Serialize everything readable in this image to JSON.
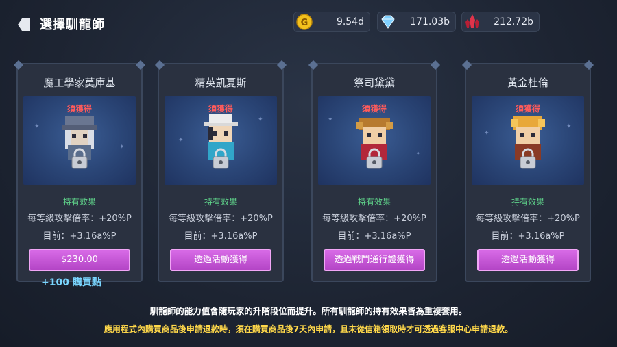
{
  "header": {
    "title": "選擇馴龍師",
    "back_icon": "back-arrow-icon",
    "currencies": [
      {
        "icon": "gold-coin-icon",
        "value": "9.54d",
        "color": "#f3c11d"
      },
      {
        "icon": "diamond-icon",
        "value": "171.03b",
        "color": "#7fd0ff"
      },
      {
        "icon": "red-crystal-icon",
        "value": "212.72b",
        "color": "#e0344b"
      }
    ]
  },
  "cards": [
    {
      "name": "魔工學家莫庫基",
      "tag": "須獲得",
      "effect_title": "持有效果",
      "effect_line1": "每等級攻擊倍率：+20%P",
      "effect_line2": "目前：+3.16a%P",
      "button": "$230.00"
    },
    {
      "name": "精英凱夏斯",
      "tag": "須獲得",
      "effect_title": "持有效果",
      "effect_line1": "每等級攻擊倍率：+20%P",
      "effect_line2": "目前：+3.16a%P",
      "button": "透過活動獲得"
    },
    {
      "name": "祭司黛黛",
      "tag": "須獲得",
      "effect_title": "持有效果",
      "effect_line1": "每等級攻擊倍率：+20%P",
      "effect_line2": "目前：+3.16a%P",
      "button": "透過戰鬥通行證獲得"
    },
    {
      "name": "黃金杜倫",
      "tag": "須獲得",
      "effect_title": "持有效果",
      "effect_line1": "每等級攻擊倍率：+20%P",
      "effect_line2": "目前：+3.16a%P",
      "button": "透過活動獲得"
    }
  ],
  "bonus_text": "+100 購買點",
  "footer": {
    "line1": "馴龍師的能力值會隨玩家的升階段位而提升。所有馴龍師的持有效果皆為重複套用。",
    "line2": "應用程式內購買商品後申請退款時，須在購買商品後7天內申請，且未從信箱領取時才可透過客服中心申請退款。"
  },
  "colors": {
    "accent_button": "#c557d6",
    "required_tag": "#ff5b5b",
    "effect_title": "#5fd28a",
    "bonus": "#7ad6ff",
    "footer_note": "#ffd84a"
  }
}
